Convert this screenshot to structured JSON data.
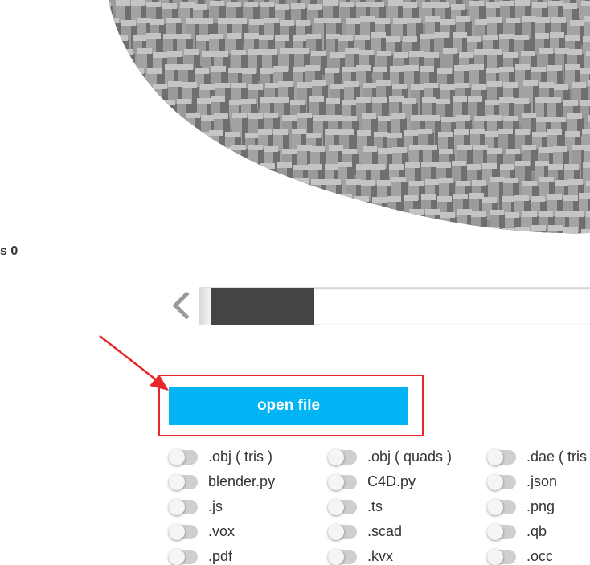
{
  "stats": {
    "label": "s 0"
  },
  "slider": {
    "prev_icon": "chevron-left-icon"
  },
  "open_button": {
    "label": "open file"
  },
  "formats": [
    [
      ".obj ( tris )",
      ".obj ( quads )",
      ".dae ( tris"
    ],
    [
      "blender.py",
      "C4D.py",
      ".json"
    ],
    [
      ".js",
      ".ts",
      ".png"
    ],
    [
      ".vox",
      ".scad",
      ".qb"
    ],
    [
      ".pdf",
      ".kvx",
      ".occ"
    ]
  ],
  "colors": {
    "button": "#03b4f4",
    "highlight": "#e8262b",
    "thumb": "#444444"
  }
}
